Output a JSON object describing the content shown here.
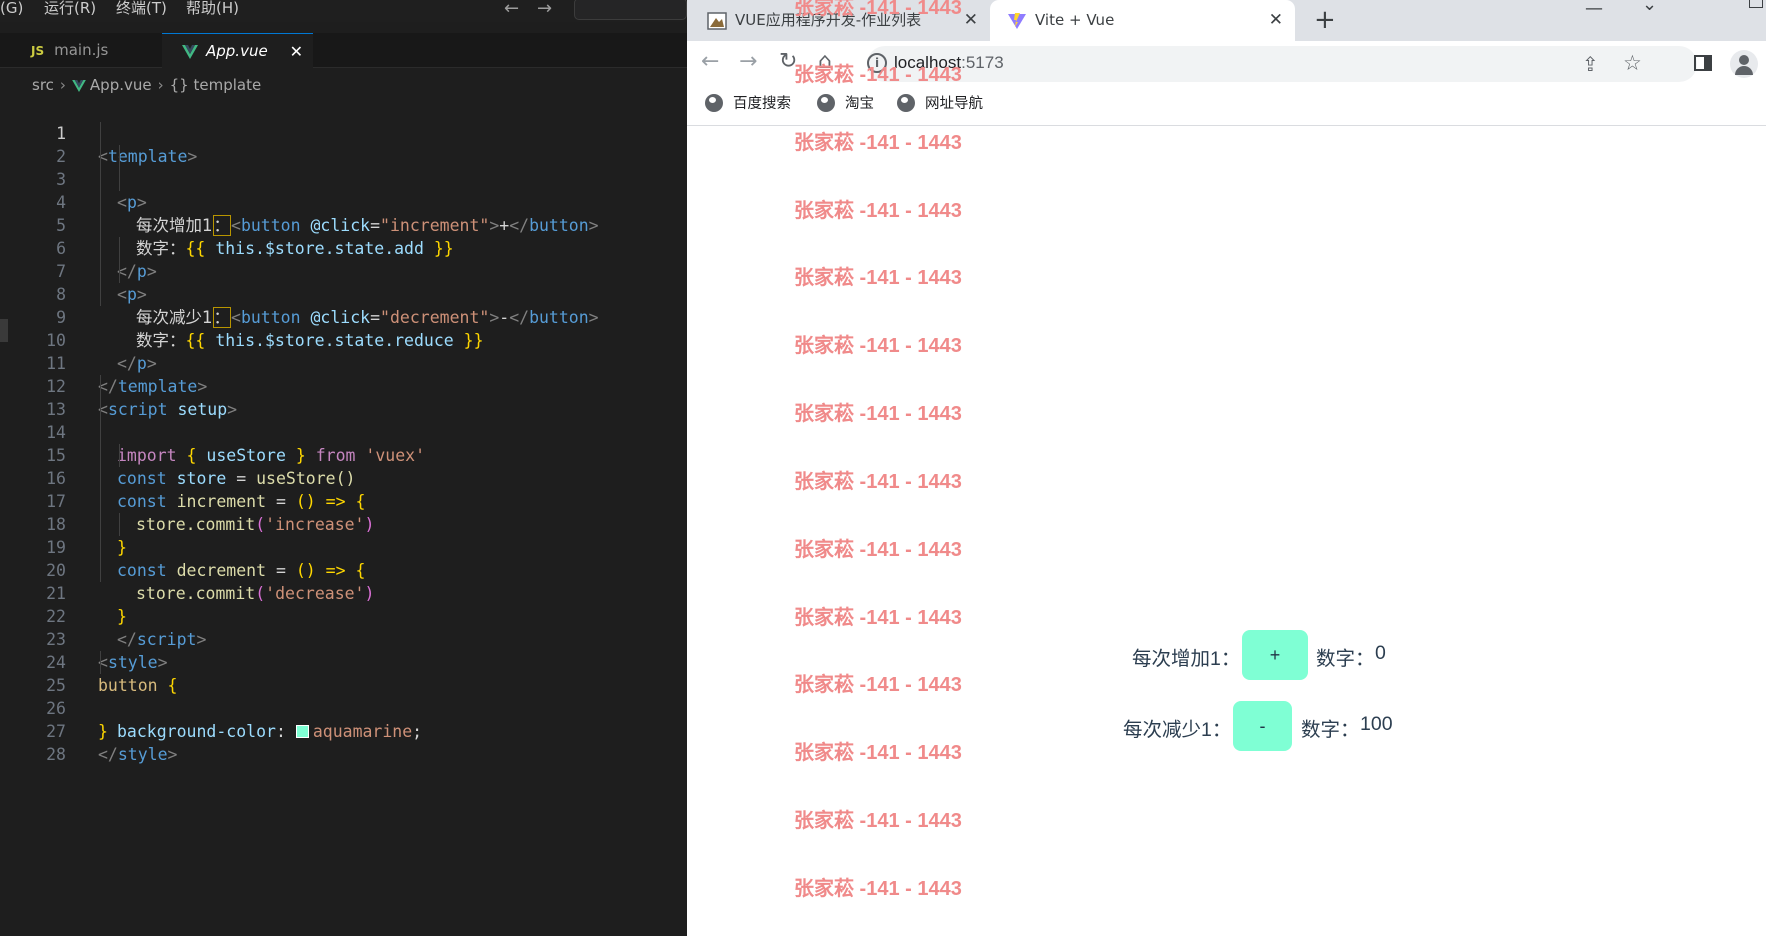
{
  "editor": {
    "menu": [
      "(G)",
      "运行(R)",
      "终端(T)",
      "帮助(H)"
    ],
    "tabs": [
      {
        "icon": "JS",
        "label": "main.js"
      },
      {
        "icon": "vue-logo-icon",
        "label": "App.vue"
      }
    ],
    "close_glyph": "✕",
    "breadcrumb": {
      "folder": "src",
      "file": "App.vue",
      "symbol_prefix": "{}",
      "symbol": "template"
    },
    "current_line": 1,
    "line_numbers": [
      "1",
      "2",
      "3",
      "4",
      "5",
      "6",
      "7",
      "8",
      "9",
      "10",
      "11",
      "12",
      "13",
      "14",
      "15",
      "16",
      "17",
      "18",
      "19",
      "20",
      "21",
      "22",
      "23",
      "24",
      "25",
      "26",
      "27",
      "28"
    ],
    "code": {
      "template_open": "template",
      "p": "p",
      "cn_increase": "每次增加1",
      "cn_colon": "：",
      "button": "button",
      "click_attr": "@click",
      "increment": "increment",
      "plus": "+",
      "cn_number": "数字：",
      "brace_open": "{{",
      "brace_close": "}}",
      "state_add": "this.$store.state.add",
      "cn_decrease": "每次减少1",
      "decrement": "decrement",
      "minus": "-",
      "state_reduce": "this.$store.state.reduce",
      "script": "script",
      "setup": "setup",
      "import_kw": "import",
      "use_store_import": "useStore",
      "from_kw": "from",
      "vuex": "'vuex'",
      "const_kw": "const",
      "store_var": "store",
      "use_store_call": "useStore()",
      "arrow": "() =>",
      "commit": "store.commit",
      "increase_str": "'increase'",
      "decrease_str": "'decrease'",
      "style": "style",
      "button_sel": "button",
      "bg_prop": "background-color",
      "aquamarine": "aquamarine",
      "swatch_color": "#7fffd4"
    }
  },
  "browser": {
    "tabs": [
      {
        "title": "VUE应用程序开发-作业列表",
        "active": false
      },
      {
        "title": "Vite + Vue",
        "active": true
      }
    ],
    "new_tab": "+",
    "url_host": "localhost",
    "url_port": ":5173",
    "bookmarks": [
      "百度搜索",
      "淘宝",
      "网址导航"
    ],
    "watermark": "张家菘 -141 - 1443",
    "app": {
      "increase_label": "每次增加1：",
      "increase_button": "+",
      "increase_number_label": "数字：",
      "increase_value": "0",
      "decrease_label": "每次减少1：",
      "decrease_button": "-",
      "decrease_number_label": "数字：",
      "decrease_value": "100",
      "button_color": "#7fffd4"
    }
  }
}
